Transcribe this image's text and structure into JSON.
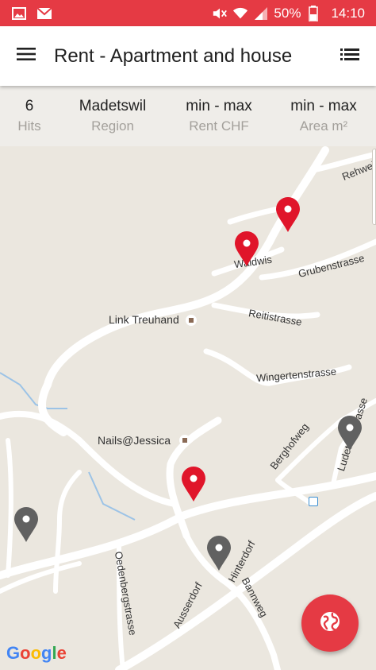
{
  "status": {
    "battery": "50%",
    "time": "14:10",
    "icons": [
      "gallery-icon",
      "email-icon",
      "mute-icon",
      "wifi-icon",
      "signal-icon",
      "battery-icon"
    ]
  },
  "appbar": {
    "title": "Rent - Apartment and house",
    "menu_icon": "hamburger-menu-icon",
    "list_icon": "list-view-icon"
  },
  "filters": [
    {
      "value": "6",
      "label": "Hits"
    },
    {
      "value": "Madetswil",
      "label": "Region"
    },
    {
      "value": "min - max",
      "label": "Rent CHF"
    },
    {
      "value": "min - max",
      "label": "Area m²"
    }
  ],
  "map": {
    "places": [
      {
        "name": "Link Treuhand"
      },
      {
        "name": "Nails@Jessica"
      }
    ],
    "streets": [
      "Rehweid",
      "Waldwis",
      "Grubenstrasse",
      "Reitistrasse",
      "Wingertenstrasse",
      "Berghofweg",
      "Ludetswilstrasse",
      "Oedenbergstrasse",
      "Ausserdorf",
      "Hinterdorf",
      "Bannweg"
    ],
    "pin_colors": {
      "active": "#e0152a",
      "inactive": "#616161"
    },
    "attribution": "Google"
  },
  "fab": {
    "icon": "globe-icon"
  },
  "colors": {
    "accent": "#e53a44",
    "map_bg": "#ebe7df",
    "road": "#ffffff"
  }
}
